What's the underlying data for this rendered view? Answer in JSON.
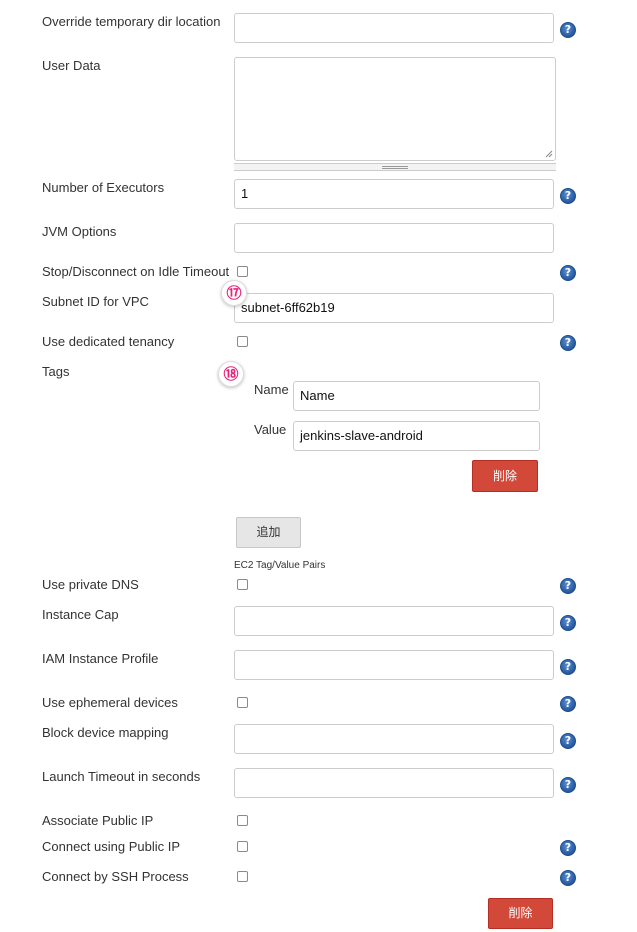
{
  "fields": {
    "override_temp_dir": {
      "label": "Override temporary dir location",
      "value": ""
    },
    "user_data": {
      "label": "User Data",
      "value": ""
    },
    "number_of_executors": {
      "label": "Number of Executors",
      "value": "1"
    },
    "jvm_options": {
      "label": "JVM Options",
      "value": ""
    },
    "stop_disconnect_idle": {
      "label": "Stop/Disconnect on Idle Timeout"
    },
    "subnet_id": {
      "label": "Subnet ID for VPC",
      "value": "subnet-6ff62b19"
    },
    "dedicated_tenancy": {
      "label": "Use dedicated tenancy"
    },
    "tags": {
      "label": "Tags",
      "name_label": "Name",
      "name_value": "Name",
      "value_label": "Value",
      "value_value": "jenkins-slave-android",
      "delete_label": "削除",
      "add_label": "追加",
      "hint": "EC2 Tag/Value Pairs"
    },
    "private_dns": {
      "label": "Use private DNS"
    },
    "instance_cap": {
      "label": "Instance Cap",
      "value": ""
    },
    "iam_profile": {
      "label": "IAM Instance Profile",
      "value": ""
    },
    "ephemeral_devices": {
      "label": "Use ephemeral devices"
    },
    "block_device_mapping": {
      "label": "Block device mapping",
      "value": ""
    },
    "launch_timeout": {
      "label": "Launch Timeout in seconds",
      "value": ""
    },
    "associate_public_ip": {
      "label": "Associate Public IP"
    },
    "connect_public_ip": {
      "label": "Connect using Public IP"
    },
    "connect_ssh_process": {
      "label": "Connect by SSH Process"
    }
  },
  "callouts": {
    "c17": "⑰",
    "c18": "⑱"
  },
  "bottom": {
    "delete_label": "削除"
  },
  "help_glyph": "?",
  "colors": {
    "delete_button": "#d24939",
    "help_icon": "#2c5fa6",
    "callout_text": "#e8217b"
  }
}
